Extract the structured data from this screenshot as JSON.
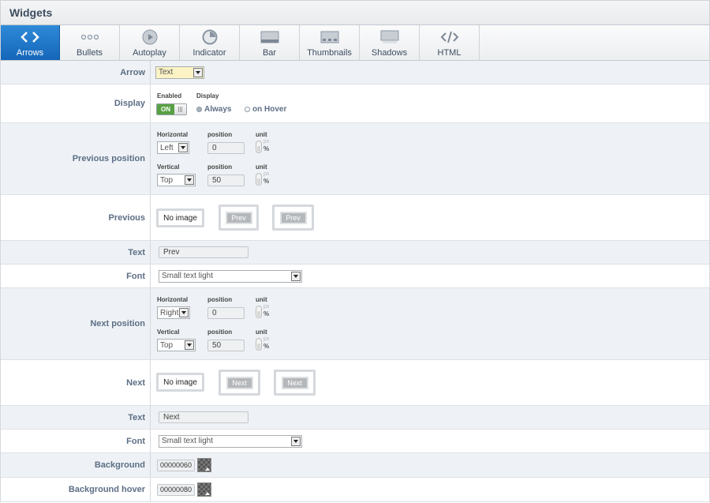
{
  "header": {
    "title": "Widgets"
  },
  "tabs": [
    {
      "label": "Arrows",
      "icon": "code-arrows-icon"
    },
    {
      "label": "Bullets",
      "icon": "dots-icon"
    },
    {
      "label": "Autoplay",
      "icon": "play-icon"
    },
    {
      "label": "Indicator",
      "icon": "pie-icon"
    },
    {
      "label": "Bar",
      "icon": "bar-icon"
    },
    {
      "label": "Thumbnails",
      "icon": "thumbnails-icon"
    },
    {
      "label": "Shadows",
      "icon": "shadow-icon"
    },
    {
      "label": "HTML",
      "icon": "html-icon"
    }
  ],
  "rows": {
    "arrow": {
      "label": "Arrow",
      "value": "Text"
    },
    "display": {
      "label": "Display",
      "enabled_label": "Enabled",
      "toggle": "ON",
      "display_label": "Display",
      "opt_always": "Always",
      "opt_hover": "on Hover"
    },
    "prev_pos": {
      "label": "Previous position",
      "h_label": "Horizontal",
      "h_value": "Left",
      "pos_label": "position",
      "h_pos": "0",
      "unit_label": "unit",
      "v_label": "Vertical",
      "v_value": "Top",
      "v_pos": "50",
      "px": "px",
      "pct": "%"
    },
    "previous": {
      "label": "Previous",
      "no_image": "No image",
      "b1": "Prev",
      "b2": "Prev"
    },
    "text1": {
      "label": "Text",
      "value": "Prev"
    },
    "font1": {
      "label": "Font",
      "value": "Small text light"
    },
    "next_pos": {
      "label": "Next position",
      "h_label": "Horizontal",
      "h_value": "Right",
      "pos_label": "position",
      "h_pos": "0",
      "unit_label": "unit",
      "v_label": "Vertical",
      "v_value": "Top",
      "v_pos": "50",
      "px": "px",
      "pct": "%"
    },
    "next": {
      "label": "Next",
      "no_image": "No image",
      "b1": "Next",
      "b2": "Next"
    },
    "text2": {
      "label": "Text",
      "value": "Next"
    },
    "font2": {
      "label": "Font",
      "value": "Small text light"
    },
    "bg": {
      "label": "Background",
      "value": "00000060"
    },
    "bg_hover": {
      "label": "Background hover",
      "value": "00000080"
    }
  },
  "colors": {
    "accent": "#1f78c9",
    "toggle_on": "#57a043",
    "label": "#5d6e85"
  }
}
